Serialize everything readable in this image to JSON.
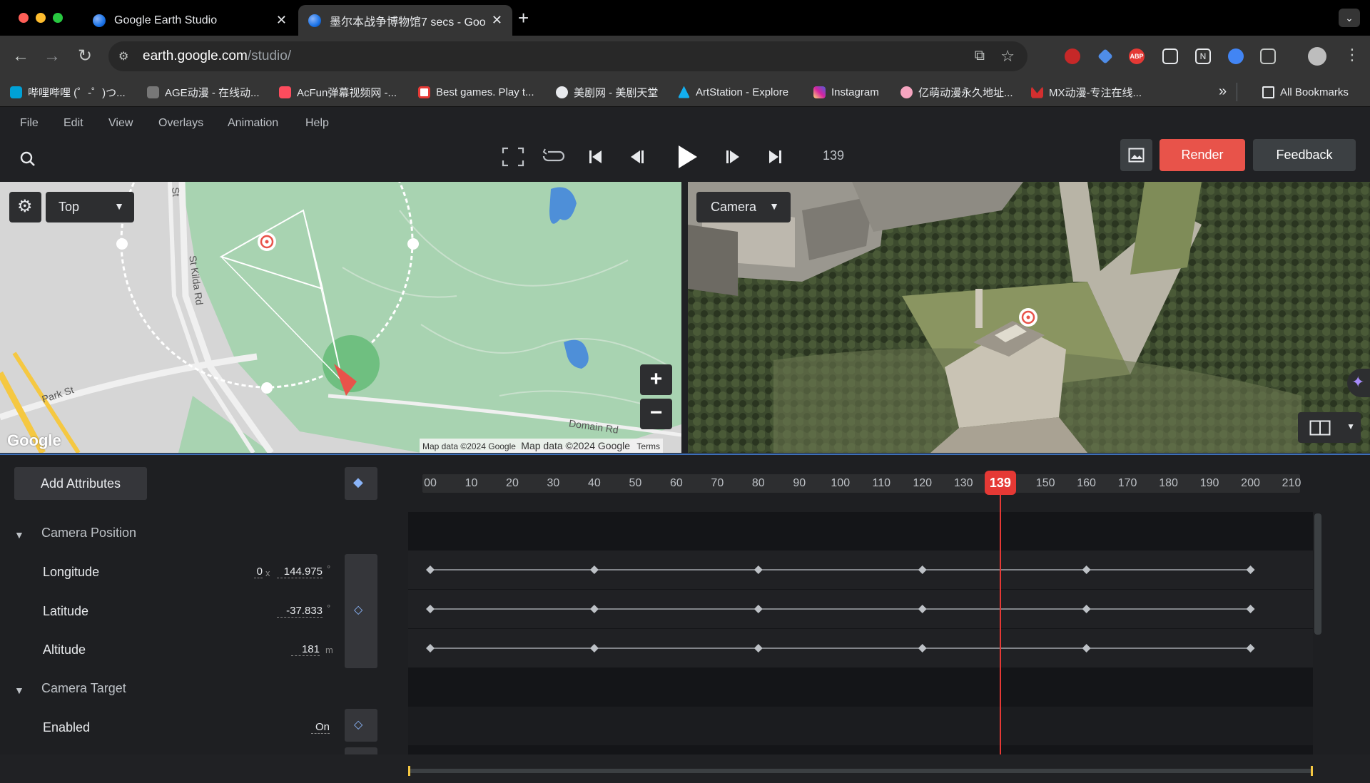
{
  "browser": {
    "tabs": [
      {
        "title": "Google Earth Studio",
        "active": false
      },
      {
        "title": "墨尔本战争博物馆7 secs - Goo",
        "active": true
      }
    ],
    "url_host": "earth.google.com",
    "url_path": "/studio/",
    "bookmarks": [
      {
        "label": "哔哩哔哩 (゜-゜)つ...",
        "color": "#00a1d6"
      },
      {
        "label": "AGE动漫 - 在线动...",
        "color": "#777777"
      },
      {
        "label": "AcFun弹幕视频网 -...",
        "color": "#fd4c5d"
      },
      {
        "label": "Best games. Play t...",
        "color": "#e53935"
      },
      {
        "label": "美剧网 - 美剧天堂",
        "color": "#e8eaed"
      },
      {
        "label": "ArtStation - Explore",
        "color": "#13aff0"
      },
      {
        "label": "Instagram",
        "color": "#d6249f"
      },
      {
        "label": "亿萌动漫永久地址...",
        "color": "#f6a5c0"
      },
      {
        "label": "MX动漫-专注在线...",
        "color": "#d32f2f"
      }
    ],
    "all_bookmarks": "All Bookmarks"
  },
  "app": {
    "menu": [
      "File",
      "Edit",
      "View",
      "Overlays",
      "Animation",
      "Help"
    ],
    "current_frame": "139",
    "render_label": "Render",
    "feedback_label": "Feedback",
    "map_view_mode": "Top",
    "camera_view_mode": "Camera",
    "map_labels": {
      "street1": "St Kilda Rd",
      "street2": "Park St",
      "street3": "Domain Rd",
      "street4": "St",
      "attribution": "Map data ©2024 Google",
      "attribution2": "Map data ©2024 Google",
      "terms": "Terms",
      "logo": "Google"
    },
    "zoom_in": "+",
    "zoom_out": "−"
  },
  "timeline": {
    "add_attributes_label": "Add Attributes",
    "ticks": [
      "00",
      "10",
      "20",
      "30",
      "40",
      "50",
      "60",
      "70",
      "80",
      "90",
      "100",
      "110",
      "120",
      "130",
      "139",
      "150",
      "160",
      "170",
      "180",
      "190",
      "200",
      "210"
    ],
    "playhead_frame": 139,
    "groups": [
      {
        "name": "Camera Position",
        "props": [
          {
            "label": "Longitude",
            "prefix": "0",
            "prefix_sep": "x",
            "value": "144.975",
            "unit": "°",
            "keyframes": [
              0,
              40,
              80,
              120,
              160,
              200
            ]
          },
          {
            "label": "Latitude",
            "value": "-37.833",
            "unit": "°",
            "keyframes": [
              0,
              40,
              80,
              120,
              160,
              200
            ]
          },
          {
            "label": "Altitude",
            "value": "181",
            "unit": "m",
            "keyframes": [
              0,
              40,
              80,
              120,
              160,
              200
            ]
          }
        ]
      },
      {
        "name": "Camera Target",
        "props": [
          {
            "label": "Enabled",
            "value": "On",
            "unit": ""
          }
        ]
      }
    ]
  },
  "colors": {
    "accent_red": "#e8534a",
    "playhead": "#e53935",
    "keyframe": "#bdc1c6",
    "selection_blue": "#3d6fb8"
  }
}
